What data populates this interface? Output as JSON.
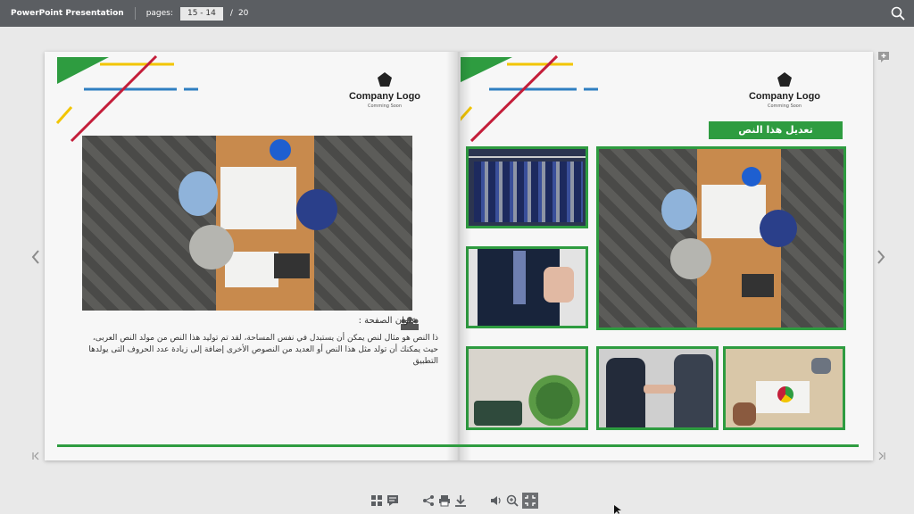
{
  "topbar": {
    "title": "PowerPoint Presentation",
    "pages_label": "pages:",
    "pages_value": "15 - 14",
    "total_separator": "/",
    "total_pages": "20"
  },
  "left_page": {
    "logo_name": "Company Logo",
    "logo_sub": "Comming Soon",
    "heading": "عنوان الصفحة :",
    "body": "ذا النص هو مثال لنص يمكن أن يستبدل في نفس المساحة، لقد تم توليد هذا النص من مولد النص العربى، حيث يمكنك أن تولد مثل هذا النص أو العديد من النصوص الأخرى إضافة إلى زيادة عدد الحروف التى يولدها التطبيق"
  },
  "right_page": {
    "logo_name": "Company Logo",
    "logo_sub": "Comming Soon",
    "banner": "تعديل هذا النص"
  },
  "colors": {
    "topbar": "#5b5e62",
    "accent_green": "#2e9c40",
    "stripe_red": "#c41e3a",
    "stripe_yellow": "#f2c500",
    "stripe_blue": "#2f7fc1"
  }
}
